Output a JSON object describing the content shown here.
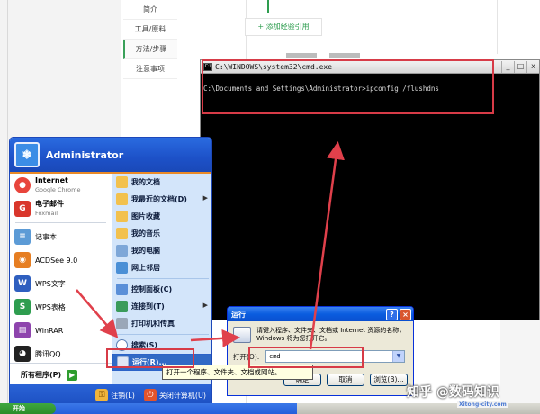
{
  "web_page": {
    "sidebar_items": [
      "简介",
      "工具/原料",
      "方法/步骤",
      "注意事项"
    ],
    "active_sidebar_index": 2,
    "add_experience_label": "+ 添加经验引用"
  },
  "cmd_window": {
    "title": "C:\\WINDOWS\\system32\\cmd.exe",
    "icon_text": "C:\\",
    "command_line": "C:\\Documents and Settings\\Administrator>ipconfig /flushdns",
    "controls": [
      "_",
      "□",
      "x"
    ]
  },
  "start_menu": {
    "user_name": "Administrator",
    "pinned": [
      {
        "label": "Internet",
        "sub": "Google Chrome",
        "icon": "chrome-icon",
        "color": "#e8453c",
        "glyph": "●"
      },
      {
        "label": "电子邮件",
        "sub": "Foxmail",
        "icon": "foxmail-icon",
        "color": "#d9362b",
        "glyph": "G"
      }
    ],
    "recent": [
      {
        "label": "记事本",
        "icon": "notepad-icon",
        "color": "#5c9bd6",
        "glyph": "≡"
      },
      {
        "label": "ACDSee 9.0",
        "icon": "acdsee-icon",
        "color": "#e67e22",
        "glyph": "◉"
      },
      {
        "label": "WPS文字",
        "icon": "wps-writer-icon",
        "color": "#2f5fbf",
        "glyph": "W"
      },
      {
        "label": "WPS表格",
        "icon": "wps-sheet-icon",
        "color": "#2e9d4f",
        "glyph": "S"
      },
      {
        "label": "WinRAR",
        "icon": "winrar-icon",
        "color": "#8e44ad",
        "glyph": "▤"
      },
      {
        "label": "腾讯QQ",
        "icon": "qq-icon",
        "color": "#222222",
        "glyph": "◕"
      }
    ],
    "all_programs": "所有程序(P)",
    "places": [
      {
        "label": "我的文档",
        "icon": "my-documents-icon",
        "color": "#f2c14e",
        "submenu": false
      },
      {
        "label": "我最近的文档(D)",
        "icon": "recent-documents-icon",
        "color": "#f2c14e",
        "submenu": true
      },
      {
        "label": "图片收藏",
        "icon": "my-pictures-icon",
        "color": "#f2c14e",
        "submenu": false
      },
      {
        "label": "我的音乐",
        "icon": "my-music-icon",
        "color": "#f2c14e",
        "submenu": false
      },
      {
        "label": "我的电脑",
        "icon": "my-computer-icon",
        "color": "#7ea7d8",
        "submenu": false
      },
      {
        "label": "网上邻居",
        "icon": "network-places-icon",
        "color": "#4a8fd6",
        "submenu": false
      }
    ],
    "system_items": [
      {
        "label": "控制面板(C)",
        "icon": "control-panel-icon",
        "color": "#5a8fd8",
        "submenu": false
      },
      {
        "label": "连接到(T)",
        "icon": "connect-to-icon",
        "color": "#3b9b5b",
        "submenu": true
      },
      {
        "label": "打印机和传真",
        "icon": "printer-icon",
        "color": "#9aa7b8",
        "submenu": false
      }
    ],
    "search_label": "搜索(S)",
    "run_label": "运行(R)...",
    "logoff_label": "注销(L)",
    "shutdown_label": "关闭计算机(U)"
  },
  "run_dialog": {
    "title": "运行",
    "description": "请键入程序、文件夹、文档或 Internet 资源的名称，Windows 将为您打开它。",
    "open_label": "打开(O):",
    "input_value": "cmd",
    "ok_label": "确定",
    "cancel_label": "取消",
    "browse_label": "浏览(B)..."
  },
  "tooltip": "打开一个程序、文件夹、文档或网站。",
  "taskbar": {
    "start_label": "开始"
  },
  "watermark": {
    "text": "知乎 @数码知识",
    "url": "Xitong-city.com"
  }
}
